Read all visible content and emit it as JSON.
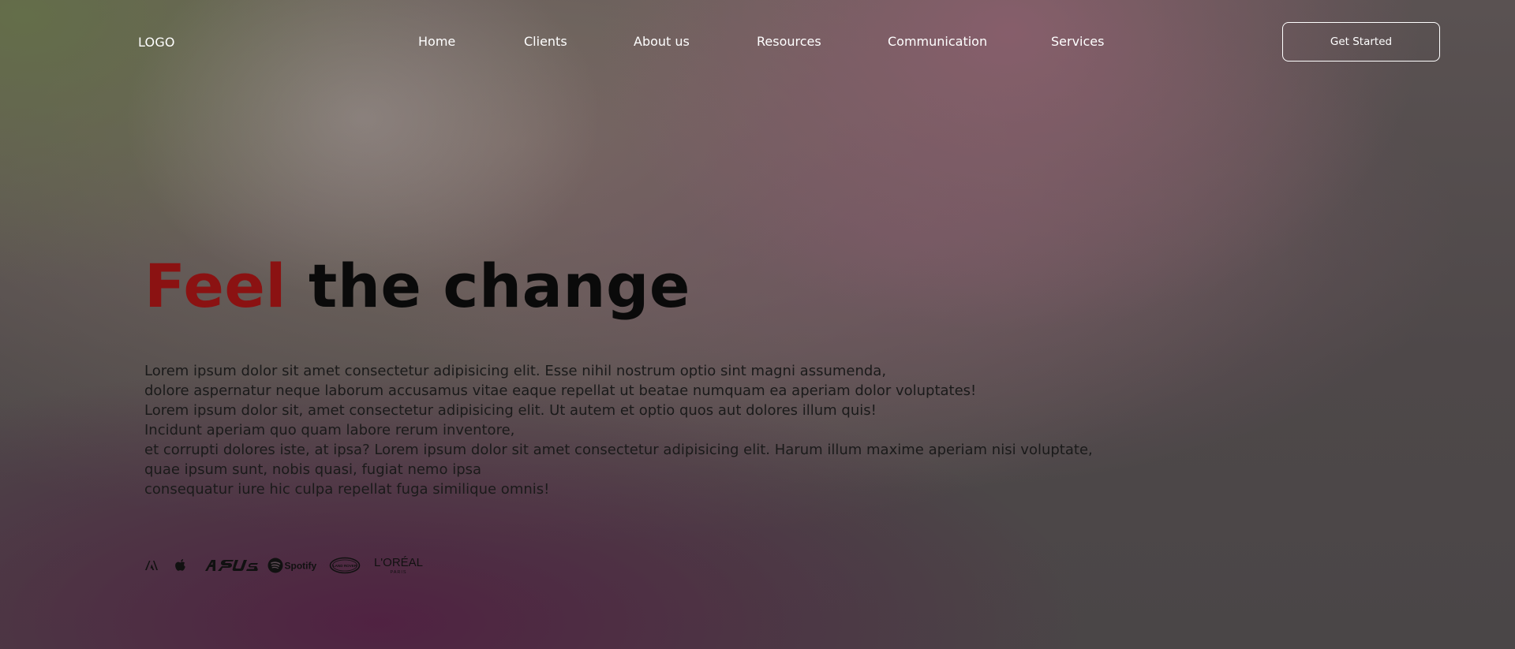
{
  "header": {
    "logo": "LOGO",
    "nav": [
      {
        "label": "Home"
      },
      {
        "label": "Clients"
      },
      {
        "label": "About us"
      },
      {
        "label": "Resources"
      },
      {
        "label": "Communication"
      },
      {
        "label": "Services"
      }
    ],
    "cta_label": "Get Started"
  },
  "hero": {
    "title_accent": "Feel",
    "title_rest": "the change",
    "accent_color": "#8b1212",
    "body_lines": [
      "Lorem ipsum dolor sit amet consectetur adipisicing elit. Esse nihil nostrum optio sint magni assumenda,",
      "dolore aspernatur neque laborum accusamus vitae eaque repellat ut beatae numquam ea aperiam dolor voluptates!",
      "Lorem ipsum dolor sit, amet consectetur adipisicing elit. Ut autem et optio quos aut dolores illum quis!",
      "Incidunt aperiam quo quam labore rerum inventore,",
      "et corrupti dolores iste, at ipsa? Lorem ipsum dolor sit amet consectetur adipisicing elit. Harum illum maxime aperiam nisi voluptate,",
      "quae ipsum sunt, nobis quasi, fugiat nemo ipsa",
      "consequatur iure hic culpa repellat fuga similique omnis!"
    ]
  },
  "brands": [
    {
      "name": "adobe-logo"
    },
    {
      "name": "apple-logo"
    },
    {
      "name": "asus-logo",
      "text": "/ISUS"
    },
    {
      "name": "spotify-logo",
      "text": "Spotify"
    },
    {
      "name": "land-rover-logo",
      "text": "LAND ROVER"
    },
    {
      "name": "loreal-logo",
      "text": "L'ORÉAL",
      "subtext": "PARIS"
    }
  ]
}
